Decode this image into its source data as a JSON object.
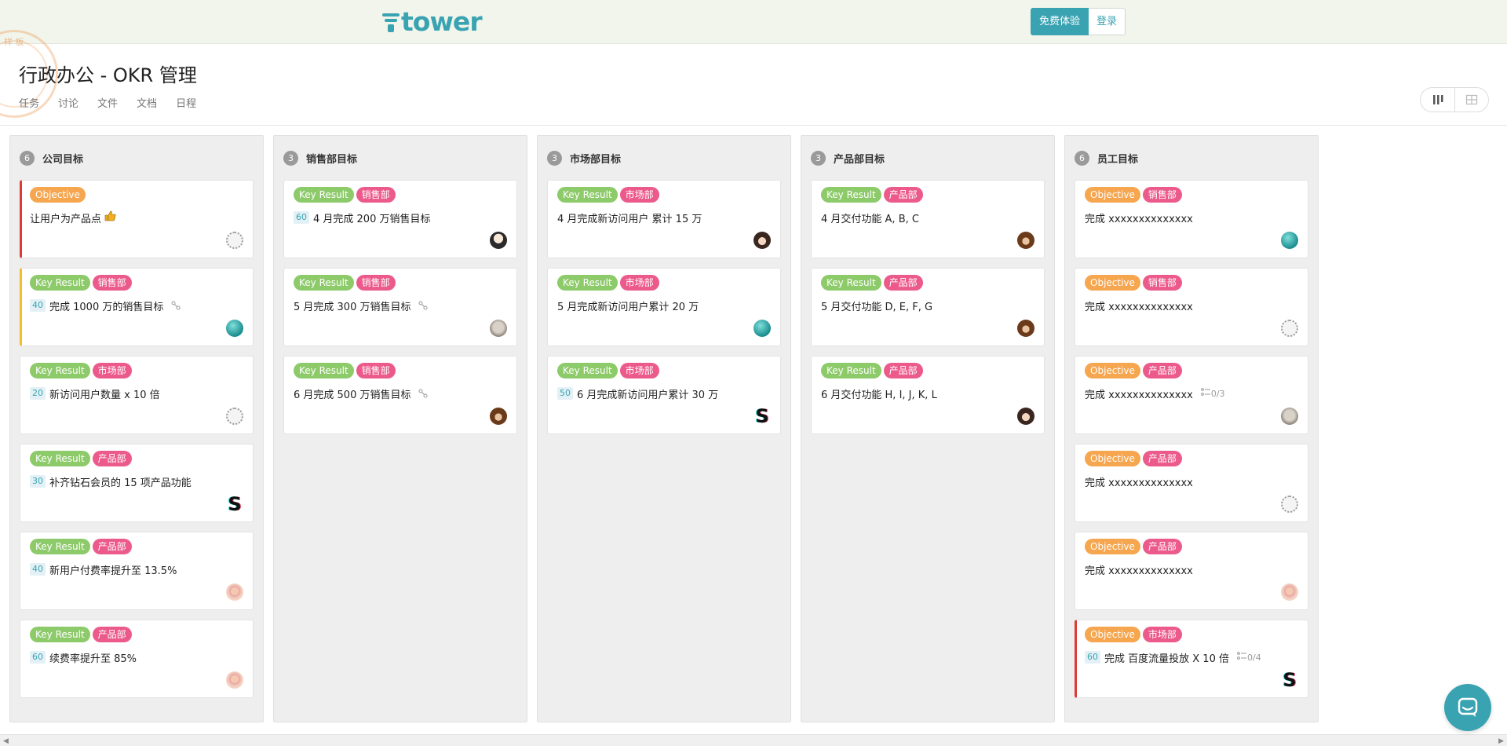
{
  "brand": {
    "name": "tower"
  },
  "auth": {
    "trial_label": "免费体验",
    "login_label": "登录"
  },
  "stamp": {
    "text": "样 板"
  },
  "project": {
    "title": "行政办公 - OKR 管理",
    "tabs": [
      "任务",
      "讨论",
      "文件",
      "文档",
      "日程"
    ]
  },
  "colors": {
    "accent": "#3aa3b2",
    "objective": "#f5a64f",
    "key_result": "#8dca6a",
    "department": "#ec5a8c",
    "priority_red": "#dc3b36",
    "priority_yellow": "#f2bc2a"
  },
  "columns": [
    {
      "name": "公司目标",
      "count": "6",
      "cards": [
        {
          "type": "Objective",
          "dept": "",
          "title": "让用户为产品点",
          "emoji": "thumbs-up-icon",
          "score": "",
          "meta": "",
          "avatar": "gray",
          "border": "red"
        },
        {
          "type": "Key Result",
          "dept": "销售部",
          "title": "完成 1000 万的销售目标",
          "score": "40",
          "meta": "link-icon",
          "avatar": "teal",
          "border": "yellow"
        },
        {
          "type": "Key Result",
          "dept": "市场部",
          "title": "新访问用户数量 x 10 倍",
          "score": "20",
          "meta": "",
          "avatar": "gray",
          "border": ""
        },
        {
          "type": "Key Result",
          "dept": "产品部",
          "title": "补齐钻石会员的 15 项产品功能",
          "score": "30",
          "meta": "",
          "avatar": "s",
          "border": ""
        },
        {
          "type": "Key Result",
          "dept": "产品部",
          "title": "新用户付费率提升至 13.5%",
          "score": "40",
          "meta": "",
          "avatar": "pink",
          "border": ""
        },
        {
          "type": "Key Result",
          "dept": "产品部",
          "title": "续费率提升至 85%",
          "score": "60",
          "meta": "",
          "avatar": "pink",
          "border": ""
        }
      ]
    },
    {
      "name": "销售部目标",
      "count": "3",
      "cards": [
        {
          "type": "Key Result",
          "dept": "销售部",
          "title": "4 月完成 200 万销售目标",
          "score": "60",
          "meta": "",
          "avatar": "dark",
          "border": ""
        },
        {
          "type": "Key Result",
          "dept": "销售部",
          "title": "5 月完成 300 万销售目标",
          "score": "",
          "meta": "link-icon",
          "avatar": "cat",
          "border": ""
        },
        {
          "type": "Key Result",
          "dept": "销售部",
          "title": "6 月完成 500 万销售目标",
          "score": "",
          "meta": "link-icon",
          "avatar": "brown",
          "border": ""
        }
      ]
    },
    {
      "name": "市场部目标",
      "count": "3",
      "cards": [
        {
          "type": "Key Result",
          "dept": "市场部",
          "title": "4 月完成新访问用户 累计 15 万",
          "score": "",
          "meta": "",
          "avatar": "girl",
          "border": ""
        },
        {
          "type": "Key Result",
          "dept": "市场部",
          "title": "5 月完成新访问用户累计 20 万",
          "score": "",
          "meta": "",
          "avatar": "teal",
          "border": ""
        },
        {
          "type": "Key Result",
          "dept": "市场部",
          "title": "6 月完成新访问用户累计 30 万",
          "score": "50",
          "meta": "",
          "avatar": "s",
          "border": ""
        }
      ]
    },
    {
      "name": "产品部目标",
      "count": "3",
      "cards": [
        {
          "type": "Key Result",
          "dept": "产品部",
          "title": "4 月交付功能 A, B, C",
          "score": "",
          "meta": "",
          "avatar": "brown",
          "border": ""
        },
        {
          "type": "Key Result",
          "dept": "产品部",
          "title": "5 月交付功能 D, E, F, G",
          "score": "",
          "meta": "",
          "avatar": "brown",
          "border": ""
        },
        {
          "type": "Key Result",
          "dept": "产品部",
          "title": "6 月交付功能 H, I, J, K, L",
          "score": "",
          "meta": "",
          "avatar": "girl",
          "border": ""
        }
      ]
    },
    {
      "name": "员工目标",
      "count": "6",
      "cards": [
        {
          "type": "Objective",
          "dept": "销售部",
          "title": "完成 xxxxxxxxxxxxxx",
          "score": "",
          "meta": "",
          "avatar": "teal",
          "border": ""
        },
        {
          "type": "Objective",
          "dept": "销售部",
          "title": "完成 xxxxxxxxxxxxxx",
          "score": "",
          "meta": "",
          "avatar": "gray",
          "border": ""
        },
        {
          "type": "Objective",
          "dept": "产品部",
          "title": "完成 xxxxxxxxxxxxxx",
          "score": "",
          "meta": "0/3",
          "avatar": "cat",
          "border": ""
        },
        {
          "type": "Objective",
          "dept": "产品部",
          "title": "完成 xxxxxxxxxxxxxx",
          "score": "",
          "meta": "",
          "avatar": "gray",
          "border": ""
        },
        {
          "type": "Objective",
          "dept": "产品部",
          "title": "完成 xxxxxxxxxxxxxx",
          "score": "",
          "meta": "",
          "avatar": "pink",
          "border": ""
        },
        {
          "type": "Objective",
          "dept": "市场部",
          "title": "完成 百度流量投放 X 10 倍",
          "score": "60",
          "meta": "0/4",
          "avatar": "s",
          "border": "red"
        }
      ]
    }
  ]
}
